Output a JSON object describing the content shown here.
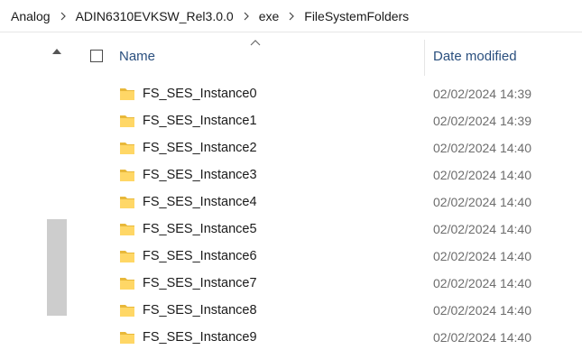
{
  "breadcrumb": {
    "items": [
      "Analog",
      "ADIN6310EVKSW_Rel3.0.0",
      "exe",
      "FileSystemFolders"
    ],
    "separator": ">"
  },
  "header": {
    "name_label": "Name",
    "date_label": "Date modified",
    "sort_icon": "chevron-up-icon"
  },
  "scroll": {
    "up_icon": "scroll-up-arrow-icon",
    "position_fraction": 0.55
  },
  "colors": {
    "folder_yellow": "#FFD766",
    "folder_shadow": "#E8B83A",
    "header_text": "#2A4F7E",
    "date_text": "#6D6D6D"
  },
  "files": [
    {
      "name": "FS_SES_Instance0",
      "date": "02/02/2024 14:39",
      "icon": "folder-icon"
    },
    {
      "name": "FS_SES_Instance1",
      "date": "02/02/2024 14:39",
      "icon": "folder-icon"
    },
    {
      "name": "FS_SES_Instance2",
      "date": "02/02/2024 14:40",
      "icon": "folder-icon"
    },
    {
      "name": "FS_SES_Instance3",
      "date": "02/02/2024 14:40",
      "icon": "folder-icon"
    },
    {
      "name": "FS_SES_Instance4",
      "date": "02/02/2024 14:40",
      "icon": "folder-icon"
    },
    {
      "name": "FS_SES_Instance5",
      "date": "02/02/2024 14:40",
      "icon": "folder-icon"
    },
    {
      "name": "FS_SES_Instance6",
      "date": "02/02/2024 14:40",
      "icon": "folder-icon"
    },
    {
      "name": "FS_SES_Instance7",
      "date": "02/02/2024 14:40",
      "icon": "folder-icon"
    },
    {
      "name": "FS_SES_Instance8",
      "date": "02/02/2024 14:40",
      "icon": "folder-icon"
    },
    {
      "name": "FS_SES_Instance9",
      "date": "02/02/2024 14:40",
      "icon": "folder-icon"
    }
  ]
}
